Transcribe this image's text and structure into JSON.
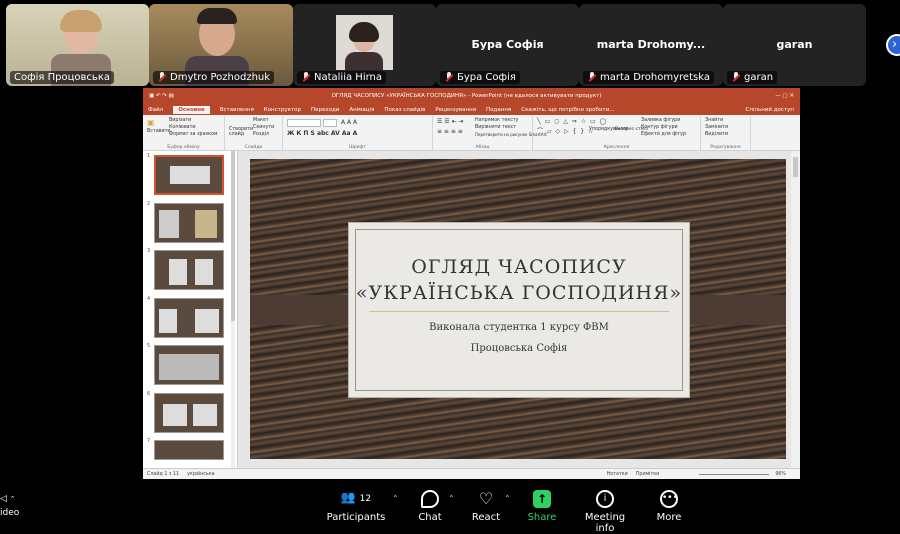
{
  "participants_strip": [
    {
      "name": "Софія Процовська",
      "video": true,
      "muted": false,
      "active": true
    },
    {
      "name": "Dmytro Pozhodzhuk",
      "video": true,
      "muted": true
    },
    {
      "name": "Nataliia Hirna",
      "video": true,
      "muted": true
    },
    {
      "name": "Бура Софія",
      "video": false,
      "muted": true
    },
    {
      "name": "marta Drohomyretska",
      "display_title": "marta Drohomy...",
      "video": false,
      "muted": true
    },
    {
      "name": "garan",
      "video": false,
      "muted": true
    }
  ],
  "powerpoint": {
    "window_title": "ОГЛЯД ЧАСОПИСУ «УКРАЇНСЬКА ГОСПОДИНЯ» - PowerPoint (не вдалося активувати продукт)",
    "share_label": "Спільний доступ",
    "tabs": [
      "Файл",
      "Основне",
      "Вставлення",
      "Конструктор",
      "Переходи",
      "Анімація",
      "Показ слайдів",
      "Рецензування",
      "Подання",
      "Скажіть, що потрібно зробити..."
    ],
    "active_tab": "Основне",
    "ribbon_groups": [
      "Буфер обміну",
      "Слайди",
      "Шрифт",
      "Абзац",
      "Креслення",
      "Редагування"
    ],
    "ribbon_items": {
      "paste": "Вставити",
      "cut": "Вирізати",
      "copy": "Копіювати",
      "format_painter": "Формат за зразком",
      "new_slide": "Створити слайд",
      "layout": "Макет",
      "reset": "Скинути",
      "section": "Розділ",
      "text_direction": "Напрямок тексту",
      "align_text": "Вирівняти текст",
      "smartart": "Перетворити на рисунок SmartArt",
      "arrange": "Упорядкування",
      "quick_styles": "Експрес-стилі",
      "shape_fill": "Заливка фігури",
      "shape_outline": "Контур фігури",
      "shape_effects": "Ефекти для фігур",
      "find": "Знайти",
      "replace": "Замінити",
      "select": "Виділити"
    },
    "slide_numbers": [
      "1",
      "2",
      "3",
      "4",
      "5",
      "6",
      "7"
    ],
    "slide": {
      "title_line1": "ОГЛЯД ЧАСОПИСУ",
      "title_line2": "«УКРАЇНСЬКА ГОСПОДИНЯ»",
      "subtitle_line1": "Виконала студентка 1 курсу ФВМ",
      "subtitle_line2": "Процовська Софія"
    },
    "status": {
      "slide_info": "Слайд 1 з 11",
      "language": "українська",
      "notes": "Нотатки",
      "comments": "Примітки",
      "zoom": "96%"
    }
  },
  "toolbar": {
    "video_label": "ideo",
    "participants_label": "Participants",
    "participants_count": "12",
    "chat_label": "Chat",
    "react_label": "React",
    "share_label": "Share",
    "meeting_info_label": "Meeting info",
    "more_label": "More"
  }
}
